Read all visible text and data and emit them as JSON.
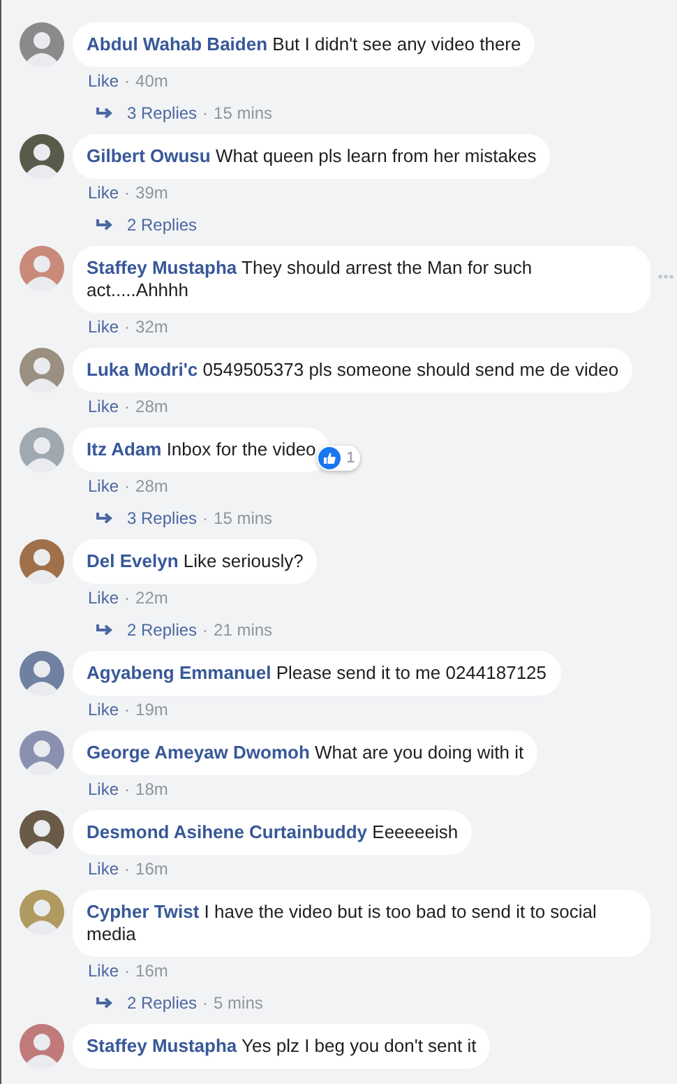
{
  "separator": "·",
  "comments": [
    {
      "name": "Abdul Wahab Baiden",
      "text": "But I didn't see any video there",
      "like": "Like",
      "time": "40m",
      "replies": {
        "label": "3 Replies",
        "time": "15 mins"
      }
    },
    {
      "name": "Gilbert Owusu",
      "text": "What queen pls learn from her mistakes",
      "like": "Like",
      "time": "39m",
      "replies": {
        "label": "2 Replies"
      }
    },
    {
      "name": "Staffey Mustapha",
      "text": "They should arrest the Man for such act.....Ahhhh",
      "like": "Like",
      "time": "32m",
      "options_visible": true
    },
    {
      "name": "Luka Modri'c",
      "text": "0549505373 pls someone should send me de video",
      "like": "Like",
      "time": "28m"
    },
    {
      "name": "Itz Adam",
      "text": "Inbox for the video",
      "like": "Like",
      "time": "28m",
      "reaction": {
        "count": "1"
      },
      "replies": {
        "label": "3 Replies",
        "time": "15 mins"
      }
    },
    {
      "name": "Del Evelyn",
      "text": "Like seriously?",
      "like": "Like",
      "time": "22m",
      "replies": {
        "label": "2 Replies",
        "time": "21 mins"
      }
    },
    {
      "name": "Agyabeng Emmanuel",
      "text": "Please send it to me 0244187125",
      "like": "Like",
      "time": "19m"
    },
    {
      "name": "George Ameyaw Dwomoh",
      "text": "What are you doing with it",
      "like": "Like",
      "time": "18m"
    },
    {
      "name": "Desmond Asihene Curtainbuddy",
      "text": "Eeeeeeish",
      "like": "Like",
      "time": "16m"
    },
    {
      "name": "Cypher Twist",
      "text": "I have the video but is too bad to send it to social media",
      "like": "Like",
      "time": "16m",
      "replies": {
        "label": "2 Replies",
        "time": "5 mins"
      }
    },
    {
      "name": "Staffey Mustapha",
      "text": "Yes plz I beg you don't sent it"
    }
  ]
}
